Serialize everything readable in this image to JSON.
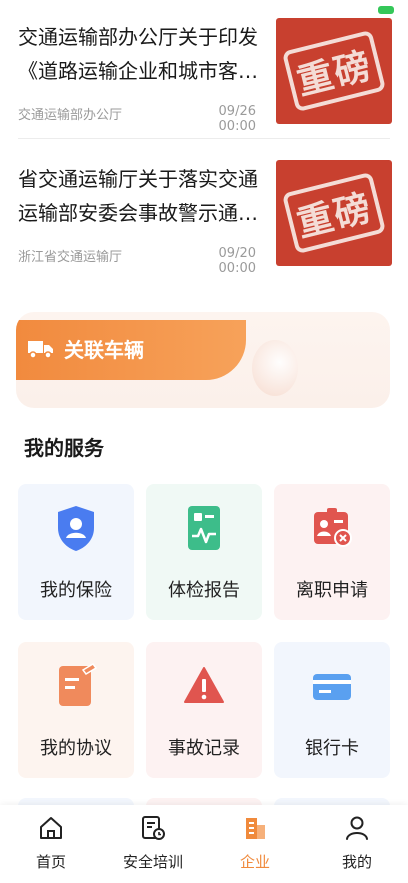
{
  "news": [
    {
      "title": "交通运输部办公厅关于印发《道路运输企业和城市客…",
      "source": "交通运输部办公厅",
      "date": "09/26 00:00",
      "thumb_text": "重磅"
    },
    {
      "title": "省交通运输厅关于落实交通运输部安委会事故警示通…",
      "source": "浙江省交通运输厅",
      "date": "09/20 00:00",
      "thumb_text": "重磅"
    }
  ],
  "vehicle": {
    "label": "关联车辆",
    "icon": "truck-icon"
  },
  "services": {
    "title": "我的服务",
    "items": [
      {
        "label": "我的保险",
        "icon": "shield-user-icon",
        "color": "#4a7cf0"
      },
      {
        "label": "体检报告",
        "icon": "health-report-icon",
        "color": "#3dbd8a"
      },
      {
        "label": "离职申请",
        "icon": "id-card-remove-icon",
        "color": "#e0554f"
      },
      {
        "label": "我的协议",
        "icon": "agreement-edit-icon",
        "color": "#f08a5c"
      },
      {
        "label": "事故记录",
        "icon": "warning-triangle-icon",
        "color": "#e0554f"
      },
      {
        "label": "银行卡",
        "icon": "bank-card-icon",
        "color": "#5aa0f0"
      }
    ]
  },
  "bottom_nav": {
    "items": [
      {
        "label": "首页",
        "icon": "home-icon"
      },
      {
        "label": "安全培训",
        "icon": "training-doc-icon"
      },
      {
        "label": "企业",
        "icon": "enterprise-building-icon",
        "active": true
      },
      {
        "label": "我的",
        "icon": "person-icon"
      }
    ],
    "active_color": "#f08a3c"
  }
}
